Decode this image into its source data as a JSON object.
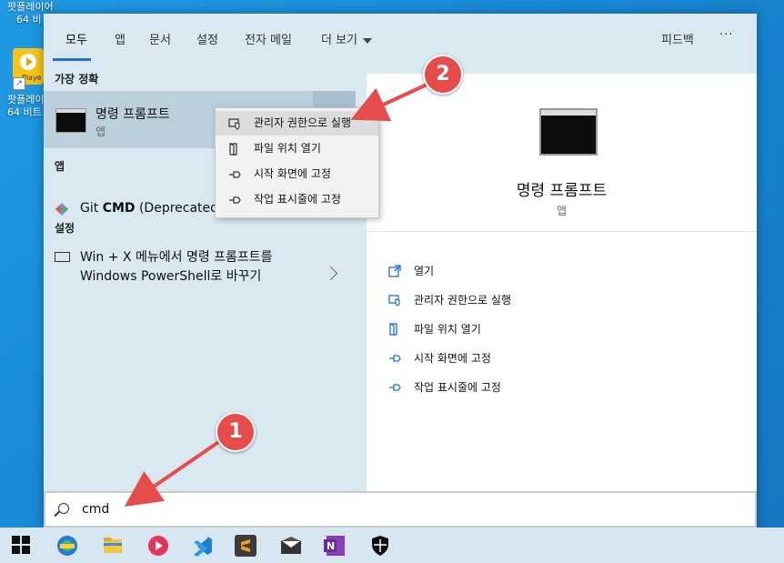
{
  "desktop": {
    "icon_top_label": [
      "팟플레이어",
      "64 비"
    ],
    "icon_label": [
      "팟플레이",
      "64 비트"
    ],
    "icon_tag": "Playe"
  },
  "tabs": [
    {
      "label": "모두",
      "active": true
    },
    {
      "label": "앱"
    },
    {
      "label": "문서"
    },
    {
      "label": "설정"
    },
    {
      "label": "전자 메일"
    },
    {
      "label": "더 보기"
    }
  ],
  "feedback_label": "피드백",
  "more_label": "···",
  "sections": {
    "best": "가장 정확",
    "apps": "앱",
    "settings": "설정"
  },
  "best_match": {
    "title": "명령 프롬프트",
    "subtitle": "앱"
  },
  "apps_list": [
    {
      "prefix": "Git ",
      "bold": "CMD",
      "suffix": " (Deprecated"
    }
  ],
  "settings_list": [
    {
      "line1": "Win + X 메뉴에서 명령 프롬프트를",
      "line2": "Windows PowerShell로 바꾸기"
    }
  ],
  "context_menu": [
    {
      "label": "관리자 권한으로 실행",
      "icon": "shield-icon"
    },
    {
      "label": "파일 위치 열기",
      "icon": "folder-icon"
    },
    {
      "label": "시작 화면에 고정",
      "icon": "pin-icon"
    },
    {
      "label": "작업 표시줄에 고정",
      "icon": "pin-icon"
    }
  ],
  "detail": {
    "title": "명령 프롬프트",
    "subtitle": "앱",
    "actions": [
      {
        "label": "열기",
        "icon": "open-icon"
      },
      {
        "label": "관리자 권한으로 실행",
        "icon": "shield-icon"
      },
      {
        "label": "파일 위치 열기",
        "icon": "folder-icon"
      },
      {
        "label": "시작 화면에 고정",
        "icon": "pin-icon"
      },
      {
        "label": "작업 표시줄에 고정",
        "icon": "pin-icon"
      }
    ]
  },
  "search": {
    "query": "cmd"
  },
  "callouts": {
    "one": "1",
    "two": "2"
  },
  "colors": {
    "accent": "#1f6fd6",
    "callout": "#e74c4c"
  }
}
